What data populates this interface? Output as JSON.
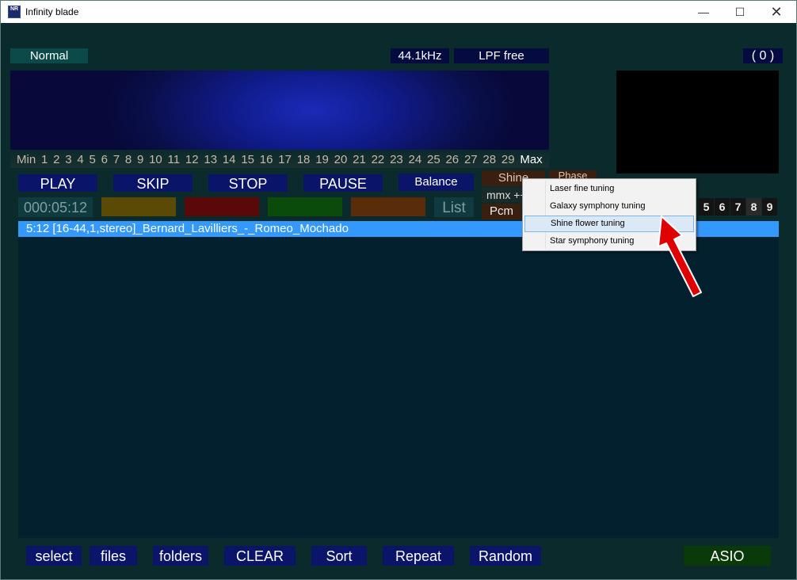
{
  "window": {
    "title": "Infinity blade",
    "icon_text": "NR",
    "minimize": "—",
    "maximize": "☐",
    "close": "✕"
  },
  "status": {
    "mode": "Normal",
    "sample_rate": "44.1kHz",
    "filter": "LPF free",
    "count": "( 0 )"
  },
  "scale": {
    "min": "Min",
    "max": "Max",
    "bands": [
      "1",
      "2",
      "3",
      "4",
      "5",
      "6",
      "7",
      "8",
      "9",
      "10",
      "11",
      "12",
      "13",
      "14",
      "15",
      "16",
      "17",
      "18",
      "19",
      "20",
      "21",
      "22",
      "23",
      "24",
      "25",
      "26",
      "27",
      "28",
      "29"
    ]
  },
  "transport": {
    "play": "PLAY",
    "skip": "SKIP",
    "stop": "STOP",
    "pause": "PAUSE",
    "balance": "Balance",
    "shine": "Shine",
    "phase": "Phase",
    "mmx": "mmx ++",
    "pcm": "Pcm",
    "list": "List"
  },
  "time": "000:05:12",
  "numbers": [
    "5",
    "6",
    "7",
    "8",
    "9"
  ],
  "playlist": {
    "tracks": [
      {
        "text": "5:12  [16-44,1,stereo]_Bernard_Lavilliers_-_Romeo_Mochado"
      }
    ]
  },
  "context_menu": {
    "items": [
      "Laser fine tuning",
      "Galaxy symphony tuning",
      "Shine flower tuning",
      "Star symphony tuning"
    ],
    "highlighted": "Shine flower tuning"
  },
  "bottom": {
    "select": "select",
    "files": "files",
    "folders": "folders",
    "clear": "CLEAR",
    "sort": "Sort",
    "repeat": "Repeat",
    "random": "Random",
    "asio": "ASIO"
  },
  "colors": {
    "background": "#0b2a2c",
    "button": "#0a1468",
    "selection": "#3399ff",
    "arrow": "#e00000"
  }
}
